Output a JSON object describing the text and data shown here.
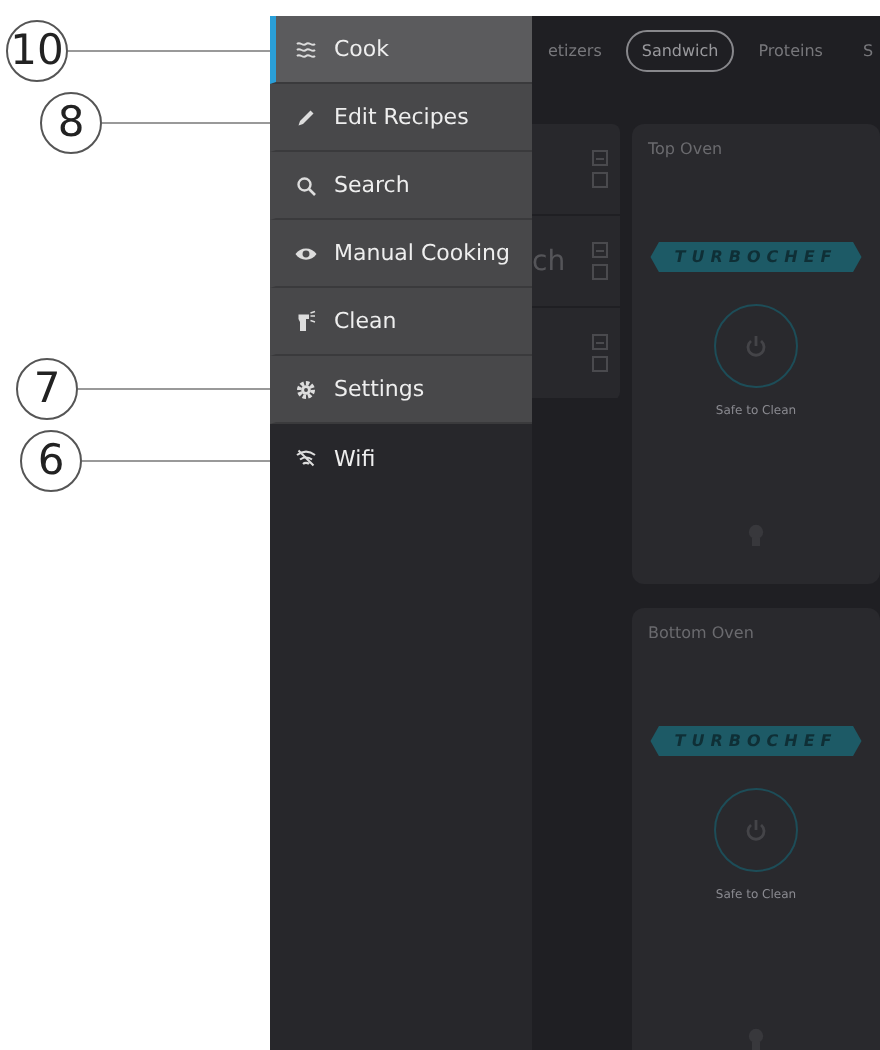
{
  "annotations": [
    {
      "label": "10"
    },
    {
      "label": "8"
    },
    {
      "label": "7"
    },
    {
      "label": "6"
    }
  ],
  "drawer": {
    "items": [
      {
        "label": "Cook",
        "kind": "cook",
        "selected": true
      },
      {
        "label": "Edit Recipes",
        "kind": "edit",
        "selected": false
      },
      {
        "label": "Search",
        "kind": "search",
        "selected": false
      },
      {
        "label": "Manual Cooking",
        "kind": "manual",
        "selected": false
      },
      {
        "label": "Clean",
        "kind": "clean",
        "selected": false
      },
      {
        "label": "Settings",
        "kind": "settings",
        "selected": false
      },
      {
        "label": "Wifi",
        "kind": "wifi",
        "selected": false
      }
    ]
  },
  "category_tabs": [
    {
      "label": "etizers",
      "selected": false
    },
    {
      "label": "Sandwich",
      "selected": true
    },
    {
      "label": "Proteins",
      "selected": false
    },
    {
      "label": "S",
      "selected": false
    }
  ],
  "recipe_rows": [
    {
      "checked": false
    },
    {
      "name": "ch",
      "checked": false
    },
    {
      "checked": false
    }
  ],
  "ovens": [
    {
      "title": "Top Oven",
      "logo": "TURBOCHEF",
      "status": "Safe to Clean"
    },
    {
      "title": "Bottom Oven",
      "logo": "TURBOCHEF",
      "status": "Safe to Clean"
    }
  ]
}
